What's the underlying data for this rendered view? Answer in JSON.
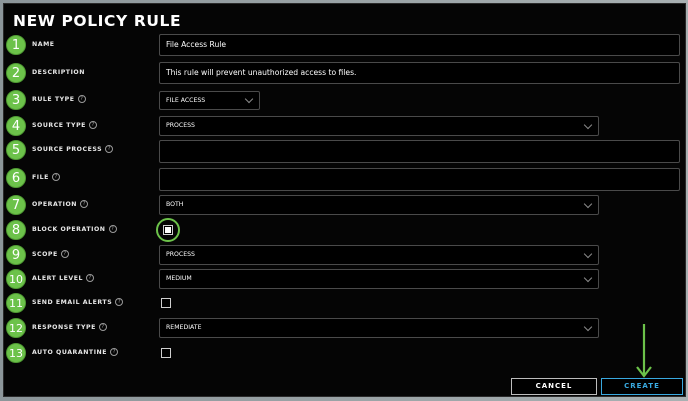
{
  "dialog": {
    "title": "NEW POLICY RULE",
    "help_glyph": "?"
  },
  "fields": {
    "name": {
      "badge": "1",
      "label": "NAME",
      "value": "File Access Rule"
    },
    "description": {
      "badge": "2",
      "label": "DESCRIPTION",
      "value": "This rule will prevent unauthorized access to files."
    },
    "rule_type": {
      "badge": "3",
      "label": "RULE TYPE",
      "value": "FILE ACCESS"
    },
    "source_type": {
      "badge": "4",
      "label": "SOURCE TYPE",
      "value": "PROCESS"
    },
    "source_process": {
      "badge": "5",
      "label": "SOURCE PROCESS",
      "value": ""
    },
    "file": {
      "badge": "6",
      "label": "FILE",
      "value": ""
    },
    "operation": {
      "badge": "7",
      "label": "OPERATION",
      "value": "BOTH"
    },
    "block_operation": {
      "badge": "8",
      "label": "BLOCK OPERATION",
      "checked": true
    },
    "scope": {
      "badge": "9",
      "label": "SCOPE",
      "value": "PROCESS"
    },
    "alert_level": {
      "badge": "10",
      "label": "ALERT LEVEL",
      "value": "MEDIUM"
    },
    "send_email_alerts": {
      "badge": "11",
      "label": "SEND EMAIL ALERTS",
      "checked": false
    },
    "response_type": {
      "badge": "12",
      "label": "RESPONSE TYPE",
      "value": "REMEDIATE"
    },
    "auto_quarantine": {
      "badge": "13",
      "label": "AUTO QUARANTINE",
      "checked": false
    }
  },
  "buttons": {
    "cancel": "CANCEL",
    "create": "CREATE"
  },
  "colors": {
    "badge_green": "#6cc24a",
    "create_blue": "#39a9e0",
    "background": "#050505"
  }
}
